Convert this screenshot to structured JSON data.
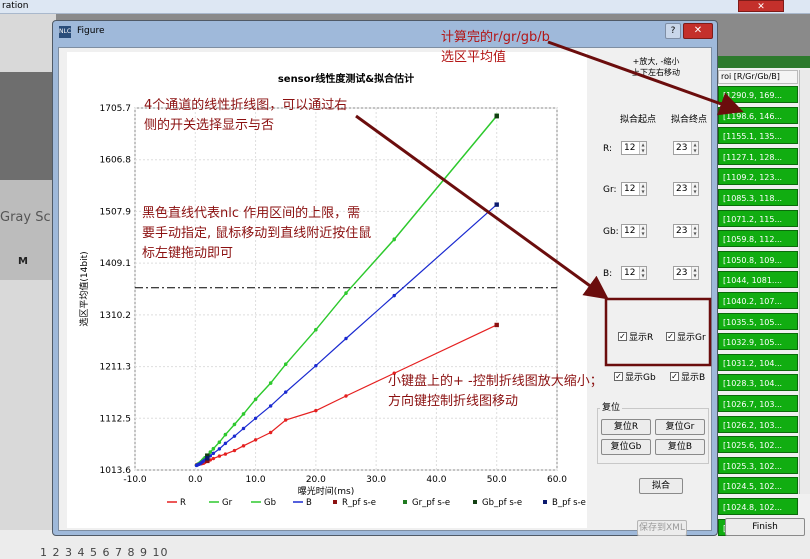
{
  "background_app": {
    "title_fragment": "ration",
    "left_gray_label": "Gray Sc",
    "left_m_label": "M",
    "bottom_text": "1 2 3 4 5 6 7 8 9 10",
    "close_glyph": "✕"
  },
  "roi_panel": {
    "header": "roi [R/Gr/Gb/B]",
    "rows": [
      "[1290.9, 169...",
      "[1198.6, 146...",
      "[1155.1, 135...",
      "[1127.1, 128...",
      "[1109.2, 123...",
      "[1085.3, 118...",
      "[1071.2, 115...",
      "[1059.8, 112...",
      "[1050.8, 109...",
      "[1044, 1081....",
      "[1040.2, 107...",
      "[1035.5, 105...",
      "[1032.9, 105...",
      "[1031.2, 104...",
      "[1028.3, 104...",
      "[1026.7, 103...",
      "[1026.2, 103...",
      "[1025.6, 102...",
      "[1025.3, 102...",
      "[1024.5, 102...",
      "[1024.8, 102...",
      "[1023.8, 102..."
    ],
    "finish_label": "Finish"
  },
  "figure": {
    "title": "Figure",
    "icon_text": "NLC",
    "help_glyph": "?",
    "close_glyph": "✕"
  },
  "chart_data": {
    "type": "line",
    "title": "sensor线性度测试&拟合估计",
    "xlabel": "曝光时间(ms)",
    "ylabel": "选区平均值(14bit)",
    "xlim": [
      -10,
      60
    ],
    "ylim": [
      1013.6,
      1705.7
    ],
    "x_ticks": [
      "-10.0",
      "0.0",
      "10.0",
      "20.0",
      "30.0",
      "40.0",
      "50.0",
      "60.0"
    ],
    "y_ticks": [
      "1013.6",
      "1112.5",
      "1211.3",
      "1310.2",
      "1409.1",
      "1507.9",
      "1606.8",
      "1705.7"
    ],
    "x": [
      0.2,
      0.4,
      0.6,
      0.8,
      1.0,
      1.2,
      1.4,
      1.6,
      2.0,
      2.5,
      3.0,
      4.0,
      5.0,
      6.5,
      8.0,
      10.0,
      12.5,
      15.0,
      20.0,
      25.0,
      33.0,
      50.0
    ],
    "series": [
      {
        "name": "R",
        "color": "#e52020",
        "values": [
          1023.8,
          1024.8,
          1024.5,
          1025.3,
          1025.6,
          1026.2,
          1026.7,
          1028.3,
          1031.2,
          1032.9,
          1035.5,
          1040.2,
          1044.0,
          1050.8,
          1059.8,
          1071.2,
          1085.3,
          1109.2,
          1127.1,
          1155.1,
          1198.6,
          1290.9
        ]
      },
      {
        "name": "Gr",
        "color": "#2ec92e",
        "values": [
          1022.8,
          1024.2,
          1025.8,
          1027.5,
          1029.8,
          1032.2,
          1034.5,
          1037.0,
          1041.5,
          1048.0,
          1054.5,
          1067.0,
          1081.5,
          1101.0,
          1121.0,
          1149.0,
          1180.0,
          1216.0,
          1282.0,
          1352.0,
          1455.0,
          1691.0
        ]
      },
      {
        "name": "Gb",
        "color": "#2ec92e",
        "values": [
          1022.6,
          1024.0,
          1025.6,
          1027.3,
          1029.6,
          1032.0,
          1034.3,
          1036.8,
          1041.2,
          1047.6,
          1054.0,
          1066.6,
          1081.0,
          1100.5,
          1120.5,
          1148.5,
          1179.5,
          1215.5,
          1281.5,
          1351.5,
          1454.0,
          1690.0
        ]
      },
      {
        "name": "B",
        "color": "#1a2ad0",
        "values": [
          1022.3,
          1023.4,
          1024.5,
          1025.6,
          1027.4,
          1029.3,
          1031.0,
          1032.8,
          1036.0,
          1040.7,
          1045.4,
          1054.0,
          1064.5,
          1078.3,
          1093.0,
          1112.5,
          1136.0,
          1162.5,
          1213.0,
          1265.0,
          1347.0,
          1521.0
        ]
      }
    ],
    "fit_endpoints": [
      {
        "name": "R_pf s-e",
        "color": "#8b1010",
        "points": [
          [
            2.0,
            1031.0
          ],
          [
            50.0,
            1290.9
          ]
        ]
      },
      {
        "name": "Gr_pf s-e",
        "color": "#1f7a1f",
        "points": [
          [
            2.0,
            1041.0
          ],
          [
            50.0,
            1691.0
          ]
        ]
      },
      {
        "name": "Gb_pf s-e",
        "color": "#123f12",
        "points": [
          [
            2.0,
            1041.0
          ],
          [
            50.0,
            1690.0
          ]
        ]
      },
      {
        "name": "B_pf s-e",
        "color": "#0b1a6e",
        "points": [
          [
            2.0,
            1036.0
          ],
          [
            50.0,
            1521.0
          ]
        ]
      }
    ],
    "nlc_upper_limit": 1362.0,
    "legend": [
      "R",
      "Gr",
      "Gb",
      "B",
      "R_pf s-e",
      "Gr_pf s-e",
      "Gb_pf s-e",
      "B_pf s-e"
    ],
    "legend_placement": "bottom",
    "grid": true
  },
  "controls": {
    "zoom_hint_lines": [
      "+放大, -缩小",
      "上下左右移动"
    ],
    "fit_start_header": "拟合起点",
    "fit_end_header": "拟合终点",
    "channels": [
      {
        "label": "R:",
        "start": "12",
        "end": "23"
      },
      {
        "label": "Gr:",
        "start": "12",
        "end": "23"
      },
      {
        "label": "Gb:",
        "start": "12",
        "end": "23"
      },
      {
        "label": "B:",
        "start": "12",
        "end": "23"
      }
    ],
    "spin_arrows": "▲\n▼",
    "checkboxes": [
      {
        "label": "显示R",
        "checked": true
      },
      {
        "label": "显示Gr",
        "checked": true
      },
      {
        "label": "显示Gb",
        "checked": true
      },
      {
        "label": "显示B",
        "checked": true
      }
    ],
    "check_glyph": "✓",
    "reset_title": "复位",
    "reset_buttons": [
      "复位R",
      "复位Gr",
      "复位Gb",
      "复位B"
    ],
    "fit_button": "拟合",
    "save_xml_button": "保存到XML"
  },
  "annotations": {
    "top_right": [
      "计算完的r/gr/gb/b",
      "选区平均值"
    ],
    "channels_note": [
      "4个通道的线性折线图，可以通过右",
      "侧的开关选择显示与否"
    ],
    "nlc_note": [
      "黑色直线代表nlc 作用区间的上限，需",
      "要手动指定, 鼠标移动到直线附近按住鼠",
      "标左键拖动即可"
    ],
    "keyboard_note": [
      "小键盘上的+ -控制折线图放大缩小；",
      "方向键控制折线图移动"
    ],
    "arrow_color": "#6b0d0d"
  }
}
